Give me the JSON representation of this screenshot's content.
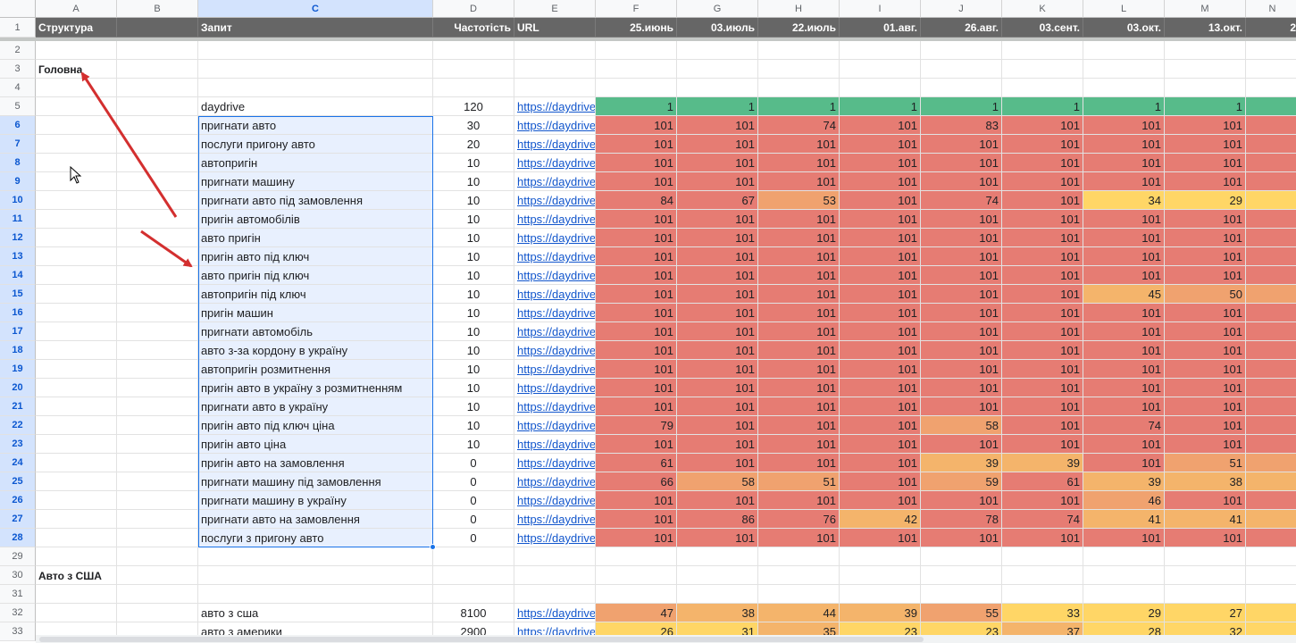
{
  "columns": [
    {
      "letter": "A"
    },
    {
      "letter": "B"
    },
    {
      "letter": "C"
    },
    {
      "letter": "D"
    },
    {
      "letter": "E"
    },
    {
      "letter": "F"
    },
    {
      "letter": "G"
    },
    {
      "letter": "H"
    },
    {
      "letter": "I"
    },
    {
      "letter": "J"
    },
    {
      "letter": "K"
    },
    {
      "letter": "L"
    },
    {
      "letter": "M"
    },
    {
      "letter": "N"
    }
  ],
  "selected_column": "C",
  "header_row": {
    "structure": "Структура",
    "query": "Запит",
    "frequency": "Частотість",
    "url": "URL",
    "dates": [
      "25.июнь",
      "03.июль",
      "22.июль",
      "01.авг.",
      "26.авг.",
      "03.сент.",
      "03.окт.",
      "13.окт.",
      "2"
    ]
  },
  "sections": {
    "main": "Головна",
    "usa": "Авто з США"
  },
  "url_text": "https://daydrive",
  "heat_colors": {
    "green": "#57bb8a",
    "red": "#e67c73",
    "light_orange": "#f0a26f",
    "orange": "#f4b46b",
    "yellow": "#ffd666"
  },
  "rows": [
    {
      "n": 5,
      "query": "daydrive",
      "freq": "120",
      "ranks": [
        "1",
        "1",
        "1",
        "1",
        "1",
        "1",
        "1",
        "1"
      ]
    },
    {
      "n": 6,
      "query": "пригнати авто",
      "freq": "30",
      "ranks": [
        "101",
        "101",
        "74",
        "101",
        "83",
        "101",
        "101",
        "101"
      ]
    },
    {
      "n": 7,
      "query": "послуги пригону авто",
      "freq": "20",
      "ranks": [
        "101",
        "101",
        "101",
        "101",
        "101",
        "101",
        "101",
        "101"
      ]
    },
    {
      "n": 8,
      "query": "автопригін",
      "freq": "10",
      "ranks": [
        "101",
        "101",
        "101",
        "101",
        "101",
        "101",
        "101",
        "101"
      ]
    },
    {
      "n": 9,
      "query": "пригнати машину",
      "freq": "10",
      "ranks": [
        "101",
        "101",
        "101",
        "101",
        "101",
        "101",
        "101",
        "101"
      ]
    },
    {
      "n": 10,
      "query": "пригнати авто під замовлення",
      "freq": "10",
      "ranks": [
        "84",
        "67",
        "53",
        "101",
        "74",
        "101",
        "34",
        "29"
      ]
    },
    {
      "n": 11,
      "query": "пригін автомобілів",
      "freq": "10",
      "ranks": [
        "101",
        "101",
        "101",
        "101",
        "101",
        "101",
        "101",
        "101"
      ]
    },
    {
      "n": 12,
      "query": "авто пригін",
      "freq": "10",
      "ranks": [
        "101",
        "101",
        "101",
        "101",
        "101",
        "101",
        "101",
        "101"
      ]
    },
    {
      "n": 13,
      "query": "пригін авто під ключ",
      "freq": "10",
      "ranks": [
        "101",
        "101",
        "101",
        "101",
        "101",
        "101",
        "101",
        "101"
      ]
    },
    {
      "n": 14,
      "query": "авто пригін під ключ",
      "freq": "10",
      "ranks": [
        "101",
        "101",
        "101",
        "101",
        "101",
        "101",
        "101",
        "101"
      ]
    },
    {
      "n": 15,
      "query": "автопригін під ключ",
      "freq": "10",
      "ranks": [
        "101",
        "101",
        "101",
        "101",
        "101",
        "101",
        "45",
        "50"
      ]
    },
    {
      "n": 16,
      "query": "пригін машин",
      "freq": "10",
      "ranks": [
        "101",
        "101",
        "101",
        "101",
        "101",
        "101",
        "101",
        "101"
      ]
    },
    {
      "n": 17,
      "query": "пригнати автомобіль",
      "freq": "10",
      "ranks": [
        "101",
        "101",
        "101",
        "101",
        "101",
        "101",
        "101",
        "101"
      ]
    },
    {
      "n": 18,
      "query": "авто з-за кордону в україну",
      "freq": "10",
      "ranks": [
        "101",
        "101",
        "101",
        "101",
        "101",
        "101",
        "101",
        "101"
      ]
    },
    {
      "n": 19,
      "query": "автопригін розмитнення",
      "freq": "10",
      "ranks": [
        "101",
        "101",
        "101",
        "101",
        "101",
        "101",
        "101",
        "101"
      ]
    },
    {
      "n": 20,
      "query": "пригін авто в україну з розмитненням",
      "freq": "10",
      "ranks": [
        "101",
        "101",
        "101",
        "101",
        "101",
        "101",
        "101",
        "101"
      ]
    },
    {
      "n": 21,
      "query": "пригнати авто в україну",
      "freq": "10",
      "ranks": [
        "101",
        "101",
        "101",
        "101",
        "101",
        "101",
        "101",
        "101"
      ]
    },
    {
      "n": 22,
      "query": "пригін авто під ключ ціна",
      "freq": "10",
      "ranks": [
        "79",
        "101",
        "101",
        "101",
        "58",
        "101",
        "74",
        "101"
      ]
    },
    {
      "n": 23,
      "query": "пригін авто ціна",
      "freq": "10",
      "ranks": [
        "101",
        "101",
        "101",
        "101",
        "101",
        "101",
        "101",
        "101"
      ]
    },
    {
      "n": 24,
      "query": "пригін авто на замовлення",
      "freq": "0",
      "ranks": [
        "61",
        "101",
        "101",
        "101",
        "39",
        "39",
        "101",
        "51"
      ]
    },
    {
      "n": 25,
      "query": "пригнати машину під замовлення",
      "freq": "0",
      "ranks": [
        "66",
        "58",
        "51",
        "101",
        "59",
        "61",
        "39",
        "38"
      ]
    },
    {
      "n": 26,
      "query": "пригнати машину в україну",
      "freq": "0",
      "ranks": [
        "101",
        "101",
        "101",
        "101",
        "101",
        "101",
        "46",
        "101"
      ]
    },
    {
      "n": 27,
      "query": "пригнати авто на замовлення",
      "freq": "0",
      "ranks": [
        "101",
        "86",
        "76",
        "42",
        "78",
        "74",
        "41",
        "41"
      ]
    },
    {
      "n": 28,
      "query": "послуги з пригону авто",
      "freq": "0",
      "ranks": [
        "101",
        "101",
        "101",
        "101",
        "101",
        "101",
        "101",
        "101"
      ]
    },
    {
      "n": 32,
      "query": "авто з сша",
      "freq": "8100",
      "ranks": [
        "47",
        "38",
        "44",
        "39",
        "55",
        "33",
        "29",
        "27"
      ]
    },
    {
      "n": 33,
      "query": "авто з америки",
      "freq": "2900",
      "ranks": [
        "26",
        "31",
        "35",
        "23",
        "23",
        "37",
        "28",
        "32"
      ]
    }
  ]
}
